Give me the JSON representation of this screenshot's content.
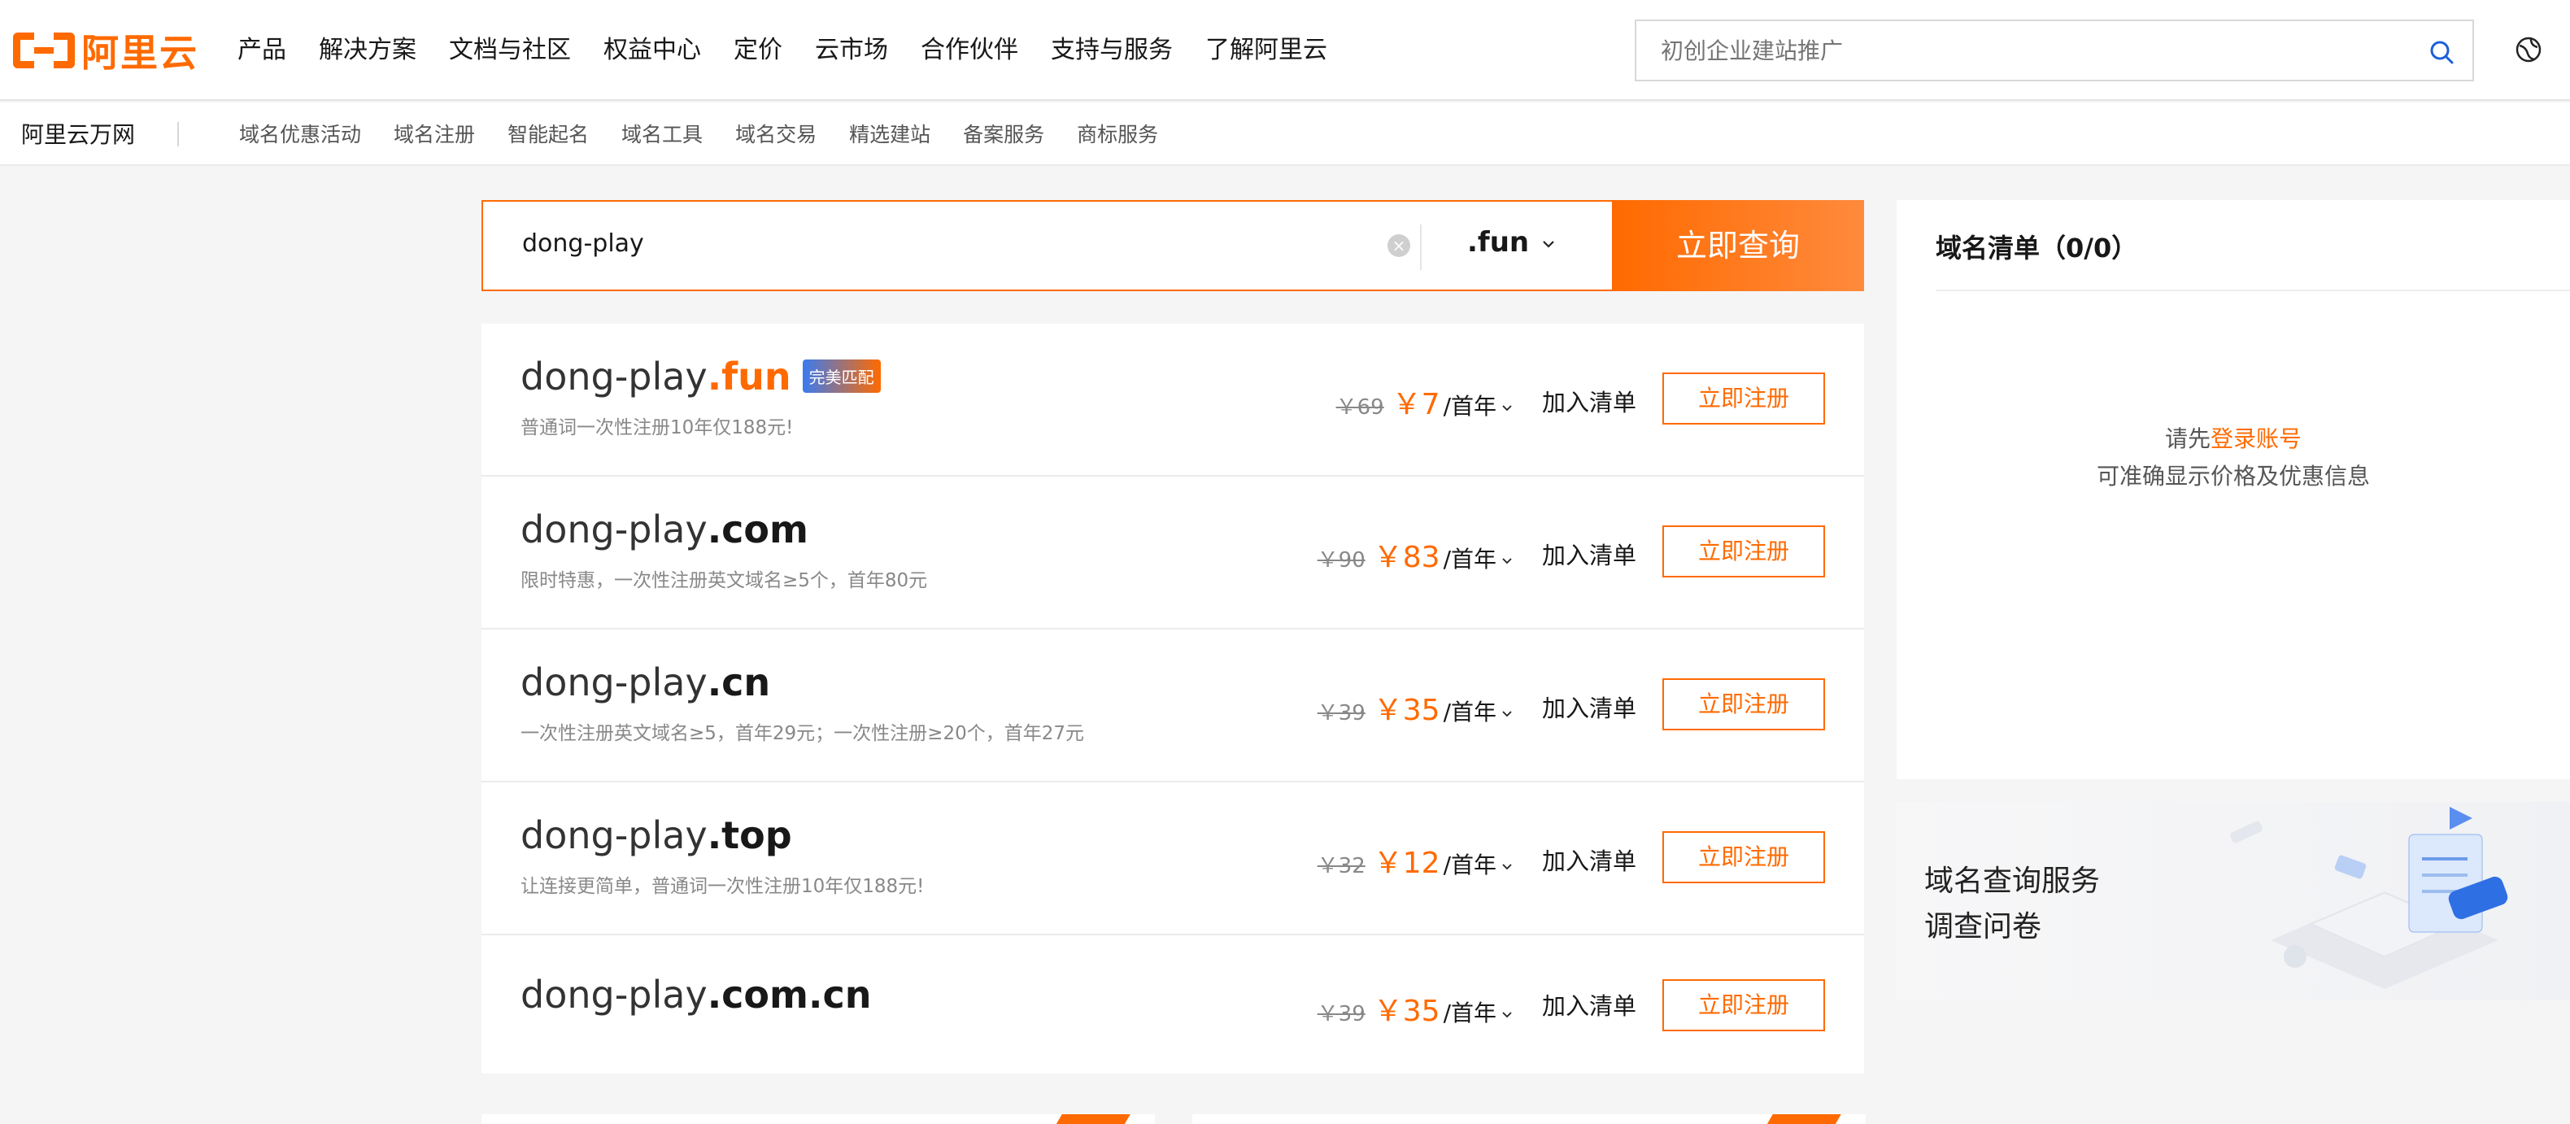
{
  "header": {
    "logo_text": "阿里云",
    "nav": [
      "产品",
      "解决方案",
      "文档与社区",
      "权益中心",
      "定价",
      "云市场",
      "合作伙伴",
      "支持与服务",
      "了解阿里云"
    ],
    "search_placeholder": "初创企业建站推广"
  },
  "subnav": {
    "brand": "阿里云万网",
    "items": [
      "域名优惠活动",
      "域名注册",
      "智能起名",
      "域名工具",
      "域名交易",
      "精选建站",
      "备案服务",
      "商标服务"
    ]
  },
  "domain_search": {
    "query": "dong-play",
    "tld": ".fun",
    "button": "立即查询"
  },
  "results": [
    {
      "name": "dong-play",
      "tld": ".fun",
      "badge": "完美匹配",
      "note": "普通词一次性注册10年仅188元!",
      "old_price": "￥69",
      "price": "￥7",
      "unit": "/首年",
      "add": "加入清单",
      "register": "立即注册"
    },
    {
      "name": "dong-play",
      "tld": ".com",
      "badge": "",
      "note": "限时特惠，一次性注册英文域名≥5个，首年80元",
      "old_price": "￥90",
      "price": "￥83",
      "unit": "/首年",
      "add": "加入清单",
      "register": "立即注册"
    },
    {
      "name": "dong-play",
      "tld": ".cn",
      "badge": "",
      "note": "一次性注册英文域名≥5，首年29元；一次性注册≥20个，首年27元",
      "old_price": "￥39",
      "price": "￥35",
      "unit": "/首年",
      "add": "加入清单",
      "register": "立即注册"
    },
    {
      "name": "dong-play",
      "tld": ".top",
      "badge": "",
      "note": "让连接更简单，普通词一次性注册10年仅188元!",
      "old_price": "￥32",
      "price": "￥12",
      "unit": "/首年",
      "add": "加入清单",
      "register": "立即注册"
    },
    {
      "name": "dong-play",
      "tld": ".com.cn",
      "badge": "",
      "note": "",
      "old_price": "￥39",
      "price": "￥35",
      "unit": "/首年",
      "add": "加入清单",
      "register": "立即注册"
    }
  ],
  "cart": {
    "title": "域名清单（0/0）",
    "login_prefix": "请先",
    "login_link": "登录账号",
    "hint": "可准确显示价格及优惠信息"
  },
  "survey": {
    "line1": "域名查询服务",
    "line2": "调查问卷"
  },
  "colors": {
    "accent": "#ff6a00",
    "background": "#f5f5f6"
  },
  "icons": [
    "aliyun-logo-icon",
    "search-icon",
    "globe-icon",
    "clear-icon",
    "chevron-down-icon"
  ]
}
